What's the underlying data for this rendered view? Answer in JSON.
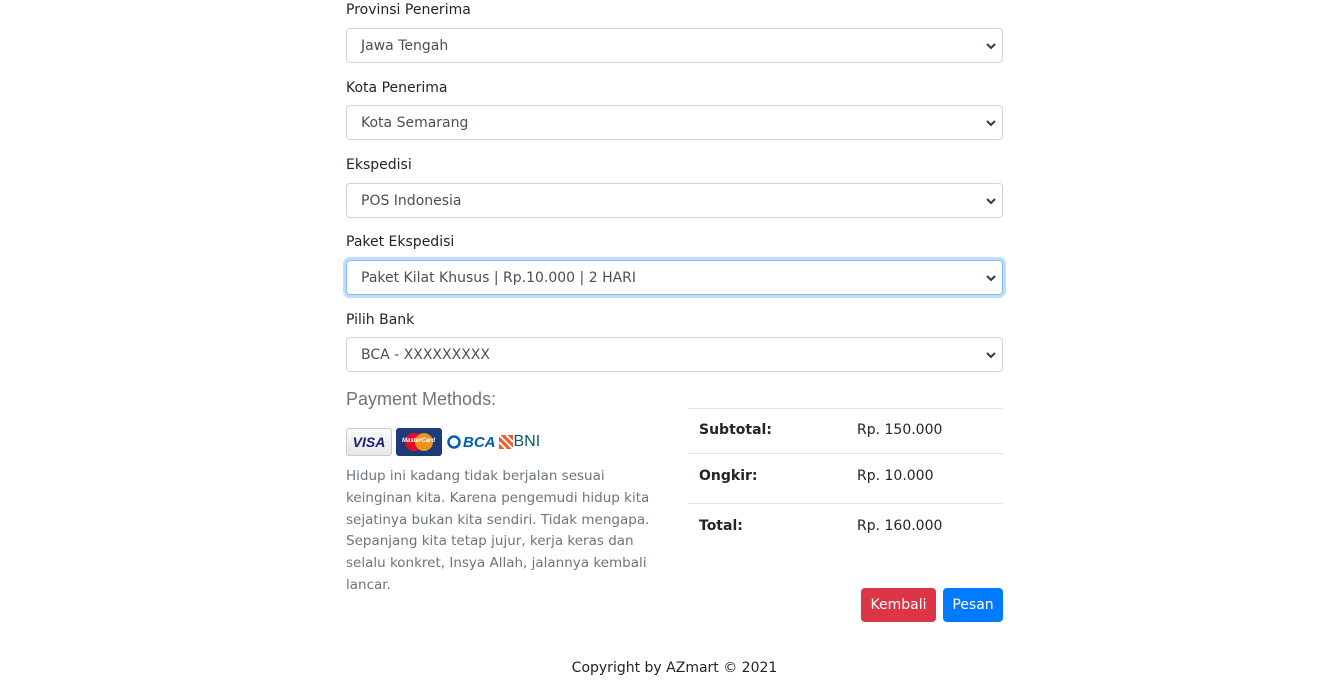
{
  "form": {
    "province": {
      "label": "Provinsi Penerima",
      "value": "Jawa Tengah"
    },
    "city": {
      "label": "Kota Penerima",
      "value": "Kota Semarang"
    },
    "courier": {
      "label": "Ekspedisi",
      "value": "POS Indonesia"
    },
    "package": {
      "label": "Paket Ekspedisi",
      "value": "Paket Kilat Khusus | Rp.10.000 | 2 HARI"
    },
    "bank": {
      "label": "Pilih Bank",
      "value": "BCA - XXXXXXXXX"
    }
  },
  "payment": {
    "title": "Payment Methods:",
    "cards": [
      "VISA",
      "MasterCard",
      "BCA",
      "BNI"
    ],
    "description": "Hidup ini kadang tidak berjalan sesuai keinginan kita. Karena pengemudi hidup kita sejatinya bukan kita sendiri. Tidak mengapa. Sepanjang kita tetap jujur, kerja keras dan selalu konkret, Insya Allah, jalannya kembali lancar."
  },
  "summary": {
    "subtotal_label": "Subtotal:",
    "subtotal_value": "Rp. 150.000",
    "shipping_label": "Ongkir:",
    "shipping_value": "Rp. 10.000",
    "total_label": "Total:",
    "total_value": "Rp. 160.000"
  },
  "actions": {
    "back_label": "Kembali",
    "order_label": "Pesan"
  },
  "footer": {
    "text": "Copyright by AZmart © 2021"
  },
  "colors": {
    "danger": "#dc3545",
    "primary": "#007bff",
    "focus": "#80bdff"
  }
}
